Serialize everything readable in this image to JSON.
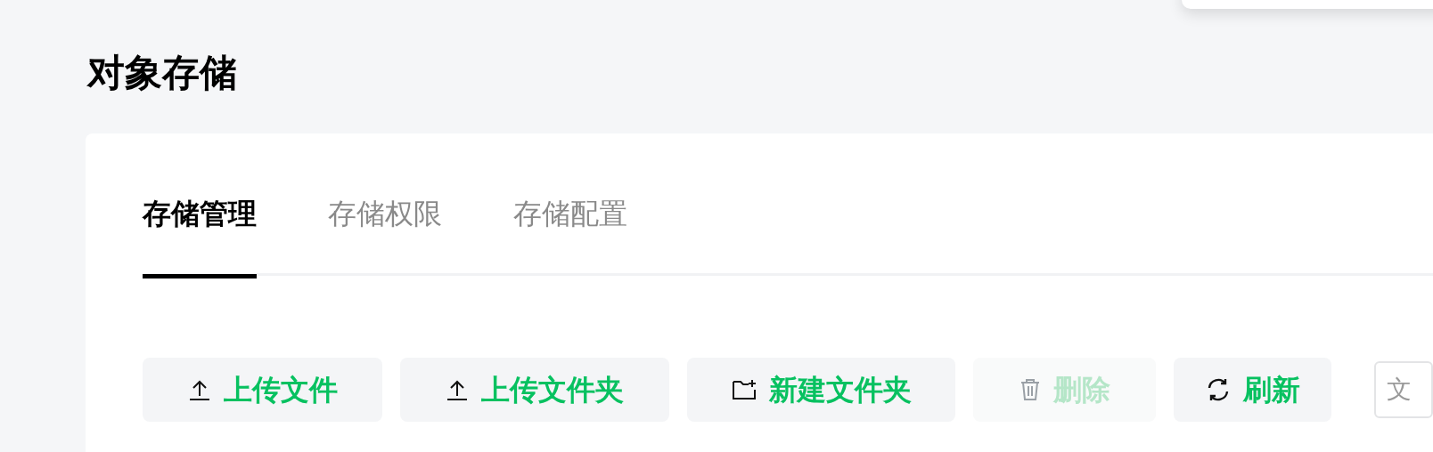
{
  "page_title": "对象存储",
  "tabs": [
    {
      "label": "存储管理",
      "selected": true
    },
    {
      "label": "存储权限",
      "selected": false
    },
    {
      "label": "存储配置",
      "selected": false
    }
  ],
  "toolbar": [
    {
      "label": "上传文件",
      "kind": "upload",
      "disabled": false
    },
    {
      "label": "上传文件夹",
      "kind": "upload",
      "disabled": false
    },
    {
      "label": "新建文件夹",
      "kind": "folder",
      "disabled": false
    },
    {
      "label": "删除",
      "kind": "delete",
      "disabled": true
    },
    {
      "label": "刷新",
      "kind": "refresh",
      "disabled": false
    }
  ],
  "search": {
    "placeholder": "文"
  }
}
